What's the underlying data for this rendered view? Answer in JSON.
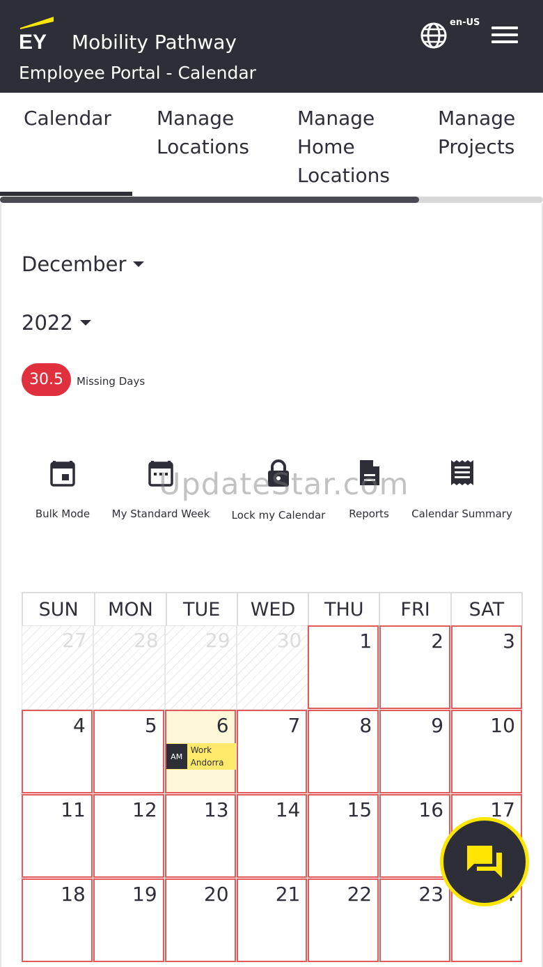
{
  "header": {
    "app_title": "Mobility Pathway",
    "subtitle": "Employee Portal - Calendar",
    "locale": "en-US",
    "logo_text": "EY"
  },
  "tabs": [
    {
      "label": "Calendar",
      "active": true
    },
    {
      "label": "Manage Locations"
    },
    {
      "label": "Manage Home Locations"
    },
    {
      "label": "Manage Projects"
    }
  ],
  "filters": {
    "month": "December",
    "year": "2022"
  },
  "missing": {
    "count": "30.5",
    "label": "Missing Days"
  },
  "actions": [
    {
      "label": "Bulk Mode",
      "icon": "calendar-icon"
    },
    {
      "label": "My Standard Week",
      "icon": "calendar-week-icon"
    },
    {
      "label": "Lock my Calendar",
      "icon": "lock-icon"
    },
    {
      "label": "Reports",
      "icon": "document-icon"
    },
    {
      "label": "Calendar Summary",
      "icon": "receipt-icon"
    }
  ],
  "watermark": "UpdateStar.com",
  "calendar": {
    "weekdays": [
      "SUN",
      "MON",
      "TUE",
      "WED",
      "THU",
      "FRI",
      "SAT"
    ],
    "weeks": [
      [
        "27",
        "28",
        "29",
        "30",
        "1",
        "2",
        "3"
      ],
      [
        "4",
        "5",
        "6",
        "7",
        "8",
        "9",
        "10"
      ],
      [
        "11",
        "12",
        "13",
        "14",
        "15",
        "16",
        "17"
      ],
      [
        "18",
        "19",
        "20",
        "21",
        "22",
        "23",
        "24"
      ]
    ],
    "entry": {
      "period": "AM",
      "line1": "Work",
      "line2": "Andorra"
    }
  },
  "colors": {
    "brand_dark": "#2e2e38",
    "brand_yellow": "#ffe600",
    "missing_red": "#e0303d",
    "cell_border": "#e25a5a"
  }
}
